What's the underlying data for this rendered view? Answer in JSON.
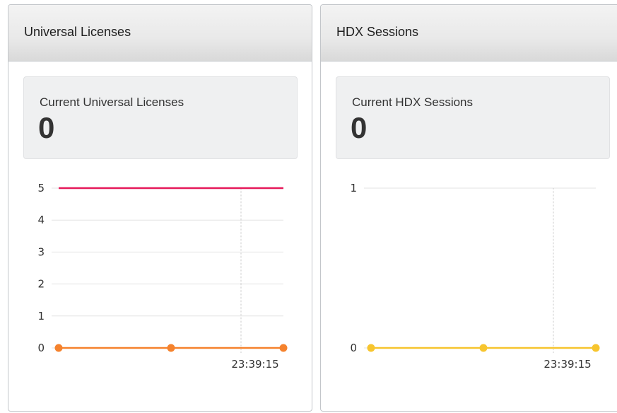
{
  "panels": [
    {
      "title": "Universal Licenses",
      "stat_label": "Current Universal Licenses",
      "stat_value": "0",
      "chart_data": {
        "type": "line",
        "yticks": [
          "0",
          "1",
          "2",
          "3",
          "4",
          "5"
        ],
        "ylim": [
          0,
          5
        ],
        "x_tick_label": "23:39:15",
        "series": [
          {
            "color": "#e6195a",
            "values": [
              5,
              5
            ]
          },
          {
            "color": "#f5822d",
            "values": [
              0,
              0,
              0
            ],
            "markers": true
          }
        ]
      }
    },
    {
      "title": "HDX Sessions",
      "stat_label": "Current HDX Sessions",
      "stat_value": "0",
      "chart_data": {
        "type": "line",
        "yticks": [
          "0",
          "1"
        ],
        "ylim": [
          0,
          1
        ],
        "x_tick_label": "23:39:15",
        "series": [
          {
            "color": "#f7c52e",
            "values": [
              0,
              0,
              0
            ],
            "markers": true
          }
        ]
      }
    }
  ]
}
